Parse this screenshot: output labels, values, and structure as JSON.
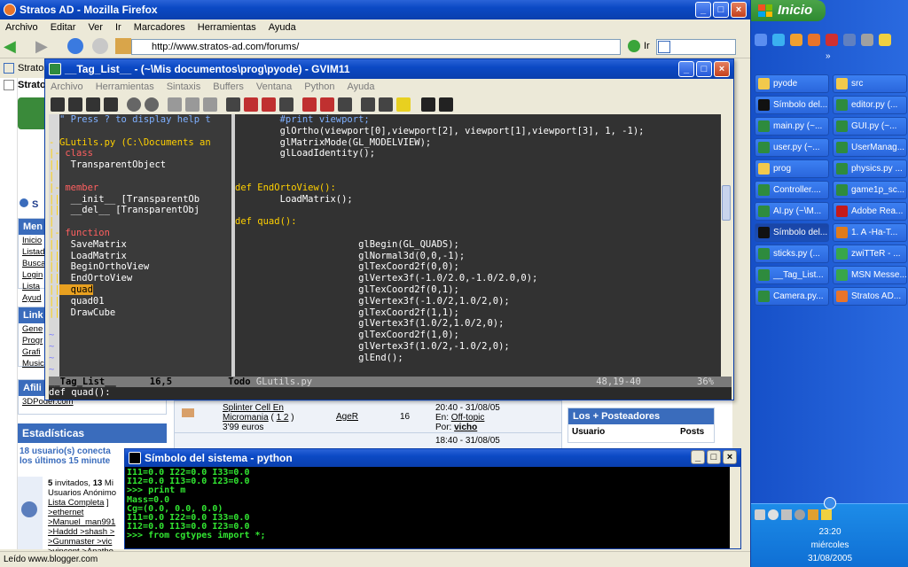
{
  "firefox": {
    "title": "Stratos AD - Mozilla Firefox",
    "menu": [
      "Archivo",
      "Editar",
      "Ver",
      "Ir",
      "Marcadores",
      "Herramientas",
      "Ayuda"
    ],
    "url": "http://www.stratos-ad.com/forums/",
    "go_label": "Ir",
    "tab1": "Stratos",
    "tab2": "Strato",
    "status": "Leído www.blogger.com"
  },
  "page": {
    "left_menu_title": "Men",
    "left_menu_items": [
      "Inicio",
      "Listad",
      "Busca",
      "Login",
      "Lista",
      "Ayud"
    ],
    "links_title": "Link",
    "links_items": [
      "Gene",
      "Progr",
      "Grafi",
      "Music"
    ],
    "afil_title": "Afili",
    "afil_link": "3DPoder.com",
    "stats_title": "Estadísticas",
    "stats_text1": "18 usuario(s) conecta",
    "stats_text2": "los últimos 15 minute",
    "stats_guests_pre": "5",
    "stats_guests_mid": " invitados, ",
    "stats_guests_bold2": "13",
    "stats_guests_post": " Mi",
    "stats_line2": "Usuarios Anónimo",
    "stats_line3": "Lista Completa",
    "stats_line3b": " ]",
    "user_list": [
      ">ethernet",
      ">Manuel_man991",
      ">Haddd >shash >",
      ">Gunmaster >vic",
      ">vincent >Anatho"
    ],
    "top_link": "S",
    "topic_title1": "Splinter Cell En",
    "topic_title2": "Micromania",
    "topic_pages": "1 2",
    "topic_sub": "3'99 euros",
    "topic_author": "AgeR",
    "topic_replies": "16",
    "topic_last_time": "20:40 - 31/08/05",
    "topic_last_in_label": "En: ",
    "topic_last_in": "Off-topic",
    "topic_last_by_label": "Por: ",
    "topic_last_by": "vicho",
    "topic2_time": "18:40 - 31/08/05",
    "posters_title": "Los + Posteadores",
    "posters_col1": "Usuario",
    "posters_col2": "Posts"
  },
  "gvim": {
    "title": "__Tag_List__ - (~\\Mis documentos\\prog\\pyode) - GVIM11",
    "menu": [
      "Archivo",
      "Herramientas",
      "Sintaxis",
      "Buffers",
      "Ventana",
      "Python",
      "Ayuda"
    ],
    "tag_lines": [
      {
        "gut": "",
        "text": "\" Press ? to display help t",
        "color": "#7fb0ff"
      },
      {
        "gut": "",
        "text": "",
        "color": "#fff"
      },
      {
        "gut": "-",
        "text": "GLutils.py (C:\\Documents an",
        "color": "#ffd000"
      },
      {
        "gut": "|-",
        "text": " class",
        "color": "#ff6060"
      },
      {
        "gut": "||",
        "text": "  TransparentObject",
        "color": "#ffffff"
      },
      {
        "gut": "|",
        "text": "",
        "color": "#fff"
      },
      {
        "gut": "|-",
        "text": " member",
        "color": "#ff6060"
      },
      {
        "gut": "||",
        "text": "  __init__ [TransparentOb",
        "color": "#ffffff"
      },
      {
        "gut": "||",
        "text": "  __del__ [TransparentObj",
        "color": "#ffffff"
      },
      {
        "gut": "|",
        "text": "",
        "color": "#fff"
      },
      {
        "gut": "|-",
        "text": " function",
        "color": "#ff6060"
      },
      {
        "gut": "||",
        "text": "  SaveMatrix",
        "color": "#ffffff"
      },
      {
        "gut": "||",
        "text": "  LoadMatrix",
        "color": "#ffffff"
      },
      {
        "gut": "||",
        "text": "  BeginOrthoView",
        "color": "#ffffff"
      },
      {
        "gut": "||",
        "text": "  EndOrtoView",
        "color": "#ffffff"
      },
      {
        "gut": "||",
        "text": "  quad",
        "color": "#000000",
        "hl": true
      },
      {
        "gut": "||",
        "text": "  quad01",
        "color": "#ffffff"
      },
      {
        "gut": "||",
        "text": "  DrawCube",
        "color": "#ffffff"
      },
      {
        "gut": "",
        "text": "",
        "color": "#fff"
      },
      {
        "gut": "~",
        "text": "",
        "color": "#8080ff"
      },
      {
        "gut": "~",
        "text": "",
        "color": "#8080ff"
      },
      {
        "gut": "~",
        "text": "",
        "color": "#8080ff"
      },
      {
        "gut": "~",
        "text": "",
        "color": "#8080ff"
      }
    ],
    "code_lines": [
      {
        "text": "        #print viewport;",
        "color": "#7fb0ff"
      },
      {
        "text": "        glOrtho(viewport[0],viewport[2], viewport[1],viewport[3], 1, -1);",
        "color": "#ffffff"
      },
      {
        "text": "        glMatrixMode(GL_MODELVIEW);",
        "color": "#ffffff"
      },
      {
        "text": "        glLoadIdentity();",
        "color": "#ffffff"
      },
      {
        "text": "",
        "color": "#fff"
      },
      {
        "text": "",
        "color": "#fff"
      },
      {
        "text": "def EndOrtoView():",
        "color": "#ffd000"
      },
      {
        "text": "        LoadMatrix();",
        "color": "#ffffff"
      },
      {
        "text": "",
        "color": "#fff"
      },
      {
        "text": "def quad():",
        "color": "#ffd000"
      },
      {
        "text": "",
        "color": "#fff"
      },
      {
        "text": "                      glBegin(GL_QUADS);",
        "color": "#ffffff"
      },
      {
        "text": "                      glNormal3d(0,0,-1);",
        "color": "#ffffff"
      },
      {
        "text": "                      glTexCoord2f(0,0);",
        "color": "#ffffff"
      },
      {
        "text": "                      glVertex3f(-1.0/2.0,-1.0/2.0,0);",
        "color": "#ffffff"
      },
      {
        "text": "                      glTexCoord2f(0,1);",
        "color": "#ffffff"
      },
      {
        "text": "                      glVertex3f(-1.0/2,1.0/2,0);",
        "color": "#ffffff"
      },
      {
        "text": "                      glTexCoord2f(1,1);",
        "color": "#ffffff"
      },
      {
        "text": "                      glVertex3f(1.0/2,1.0/2,0);",
        "color": "#ffffff"
      },
      {
        "text": "                      glTexCoord2f(1,0);",
        "color": "#ffffff"
      },
      {
        "text": "                      glVertex3f(1.0/2,-1.0/2,0);",
        "color": "#ffffff"
      },
      {
        "text": "                      glEnd();",
        "color": "#ffffff"
      }
    ],
    "status_left": "__Tag_List__      16,5          Todo",
    "status_file": "GLutils.py",
    "status_right": "48,19-40          36%",
    "cmdline": "def quad():"
  },
  "console": {
    "title": "Símbolo del sistema - python",
    "lines": "I11=0.0 I22=0.0 I33=0.0\nI12=0.0 I13=0.0 I23=0.0\n>>> print m\nMass=0.0\nCg=(0.0, 0.0, 0.0)\nI11=0.0 I22=0.0 I33=0.0\nI12=0.0 I13=0.0 I23=0.0\n>>> from cgtypes import *;"
  },
  "taskbar": {
    "start": "Inicio",
    "items": [
      {
        "label": "pyode",
        "icon": "folder"
      },
      {
        "label": "src",
        "icon": "folder"
      },
      {
        "label": "Símbolo del...",
        "icon": "cmd"
      },
      {
        "label": "editor.py (...",
        "icon": "vim"
      },
      {
        "label": "main.py (~...",
        "icon": "vim"
      },
      {
        "label": "GUI.py (~...",
        "icon": "vim"
      },
      {
        "label": "user.py (~...",
        "icon": "vim"
      },
      {
        "label": "UserManag...",
        "icon": "vim"
      },
      {
        "label": "prog",
        "icon": "folder"
      },
      {
        "label": "physics.py ...",
        "icon": "vim"
      },
      {
        "label": "Controller....",
        "icon": "vim"
      },
      {
        "label": "game1p_sc...",
        "icon": "vim"
      },
      {
        "label": "AI.py (~\\M...",
        "icon": "vim"
      },
      {
        "label": "Adobe Rea...",
        "icon": "adobe"
      },
      {
        "label": "Símbolo del...",
        "icon": "cmd",
        "active": true
      },
      {
        "label": "1. A -Ha-T...",
        "icon": "winamp"
      },
      {
        "label": "sticks.py (...",
        "icon": "vim"
      },
      {
        "label": "zwiTTeR - ...",
        "icon": "msn"
      },
      {
        "label": "__Tag_List...",
        "icon": "vim"
      },
      {
        "label": "MSN Messe...",
        "icon": "msn"
      },
      {
        "label": "Camera.py...",
        "icon": "vim"
      },
      {
        "label": "Stratos AD...",
        "icon": "firefox"
      }
    ],
    "clock_time": "23:20",
    "clock_day": "miércoles",
    "clock_date": "31/08/2005"
  },
  "colors": {
    "folder": "#f2c94c",
    "vim": "#2e8b3e",
    "cmd": "#111111",
    "adobe": "#c41a1a",
    "winamp": "#e07b1b",
    "msn": "#38a64a",
    "firefox": "#e8742a"
  }
}
